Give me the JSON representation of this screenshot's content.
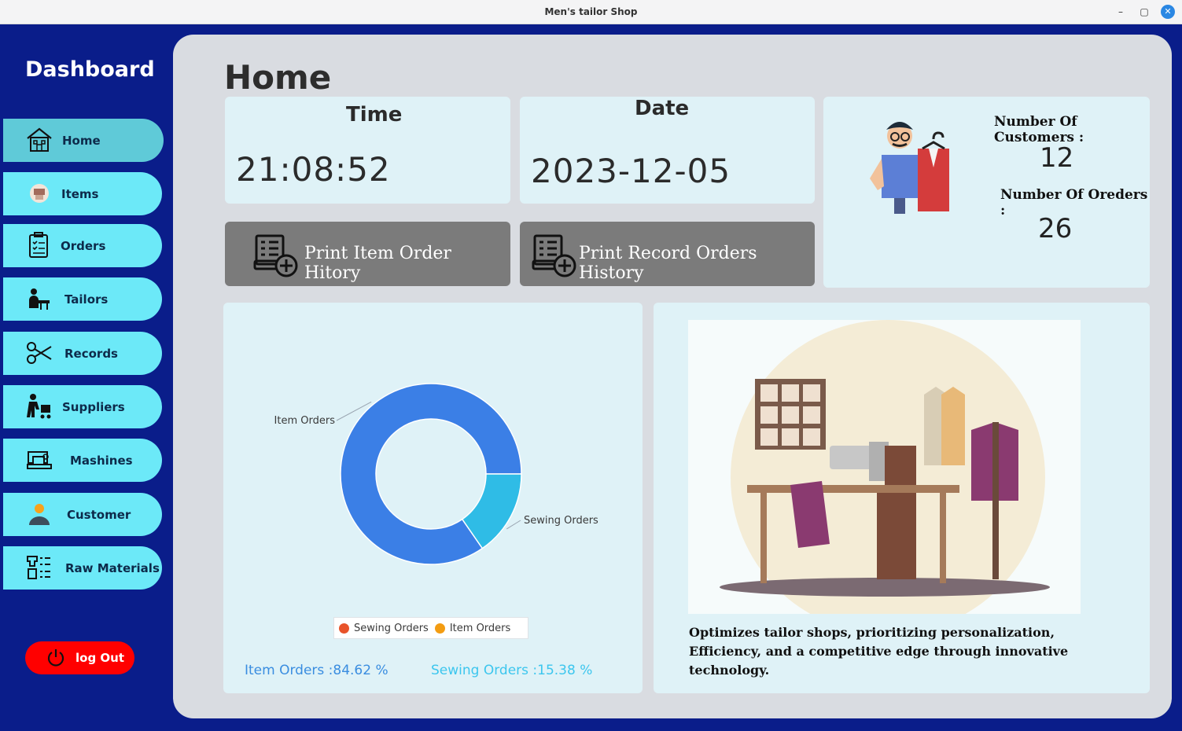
{
  "window": {
    "title": "Men's tailor Shop",
    "min": "–",
    "max": "▢",
    "close": "✕"
  },
  "sidebar": {
    "title": "Dashboard",
    "items": [
      {
        "label": "Home",
        "icon": "home-icon",
        "active": true
      },
      {
        "label": "Items",
        "icon": "items-icon"
      },
      {
        "label": "Orders",
        "icon": "orders-icon"
      },
      {
        "label": "Tailors",
        "icon": "tailor-icon"
      },
      {
        "label": "Records",
        "icon": "scissors-icon"
      },
      {
        "label": "Suppliers",
        "icon": "supplier-icon"
      },
      {
        "label": "Mashines",
        "icon": "sewing-machine-icon"
      },
      {
        "label": "Customer",
        "icon": "customer-icon"
      },
      {
        "label": "Raw Materials",
        "icon": "raw-materials-icon"
      }
    ],
    "logout": "log Out"
  },
  "main": {
    "title": "Home",
    "time": {
      "label": "Time",
      "value": "21:08:52"
    },
    "date": {
      "label": "Date",
      "value": "2023-12-05"
    },
    "print_item": "Print Item Order Hitory",
    "print_record": "Print Record Orders History",
    "stats": {
      "customers_label": "Number Of Customers :",
      "customers_value": "12",
      "orders_label": "Number Of Oreders  :",
      "orders_value": "26"
    },
    "description_line1": "Optimizes tailor shops, prioritizing personalization,",
    "description_line2": "Efficiency, and a competitive edge through innovative technology."
  },
  "chart_data": {
    "type": "pie",
    "categories": [
      "Item Orders",
      "Sewing Orders"
    ],
    "values": [
      84.62,
      15.38
    ],
    "legend": [
      "Sewing Orders",
      "Item Orders"
    ],
    "legend_placement": "bottom",
    "summary": [
      "Item Orders :84.62  %",
      "Sewing Orders :15.38  %"
    ],
    "colors": {
      "item": "#3b7fe6",
      "sewing": "#2fbce6",
      "legend_sewing": "#e8532a",
      "legend_item": "#f39c12",
      "summary_item": "#3a8de0",
      "summary_sewing": "#3cc6ee"
    }
  }
}
